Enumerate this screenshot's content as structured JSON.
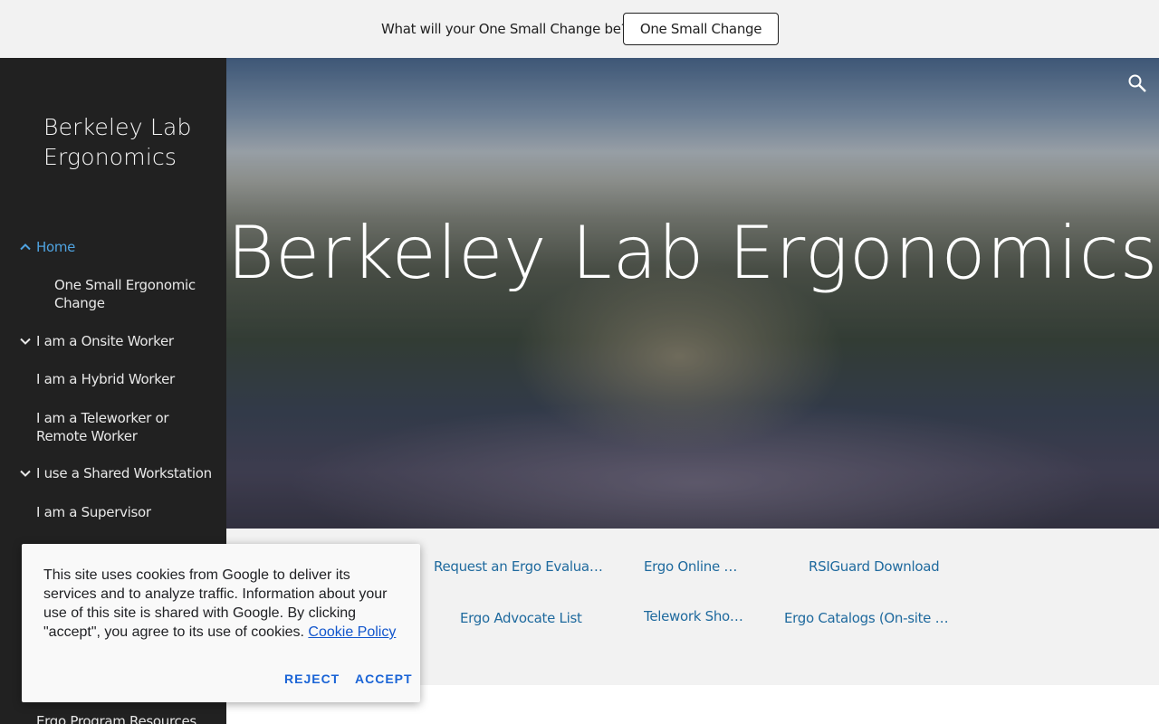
{
  "banner": {
    "text": "What will your One Small Change be?",
    "button_label": "One Small Change"
  },
  "sidebar": {
    "site_title": "Berkeley Lab Ergonomics",
    "items": [
      {
        "label": "Home",
        "expanded": true,
        "active": true
      },
      {
        "label": "One Small Ergonomic Change",
        "level": 2
      },
      {
        "label": "I am a Onsite Worker",
        "expandable": true
      },
      {
        "label": "I am a Hybrid Worker"
      },
      {
        "label": "I am a Teleworker or Remote Worker"
      },
      {
        "label": "I use a Shared Workstation",
        "expandable": true
      },
      {
        "label": "I am a Supervisor"
      },
      {
        "label": "Ergo Program Resources"
      }
    ]
  },
  "hero": {
    "title": "Berkeley Lab Ergonomics"
  },
  "links": [
    {
      "label": "Request an Ergo Evaluation"
    },
    {
      "label": "Ergo Online Tr…"
    },
    {
      "label": "RSIGuard Download"
    },
    {
      "label": "Ergo Advocate List"
    },
    {
      "label": "Telework Shop…"
    },
    {
      "label": "Ergo Catalogs (On-site onl…"
    }
  ],
  "cookie": {
    "text": "This site uses cookies from Google to deliver its services and to analyze traffic. Information about your use of this site is shared with Google. By clicking \"accept\", you agree to its use of cookies.",
    "policy_link": "Cookie Policy",
    "reject_label": "Reject",
    "accept_label": "Accept"
  },
  "colors": {
    "sidebar_bg": "#212121",
    "active_nav": "#4fa3e0",
    "link": "#1f6a9e",
    "cookie_button": "#1a64d6"
  }
}
